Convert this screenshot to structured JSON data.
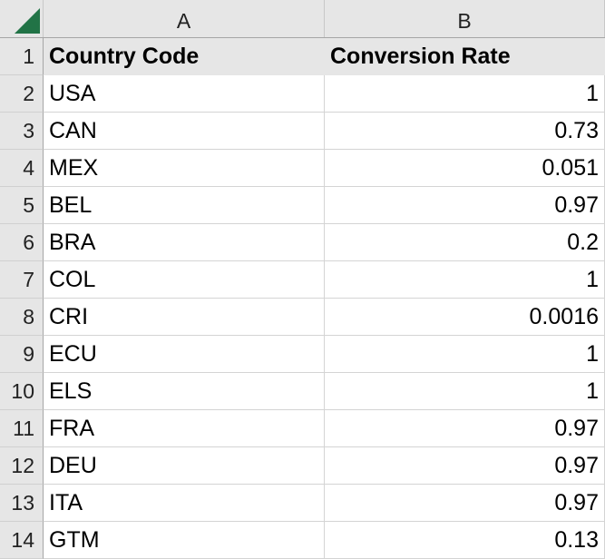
{
  "columns": [
    "A",
    "B"
  ],
  "header": {
    "row": "1",
    "a": "Country Code",
    "b": "Conversion Rate"
  },
  "rows": [
    {
      "row": "2",
      "code": "USA",
      "rate": "1"
    },
    {
      "row": "3",
      "code": "CAN",
      "rate": "0.73"
    },
    {
      "row": "4",
      "code": "MEX",
      "rate": "0.051"
    },
    {
      "row": "5",
      "code": "BEL",
      "rate": "0.97"
    },
    {
      "row": "6",
      "code": "BRA",
      "rate": "0.2"
    },
    {
      "row": "7",
      "code": "COL",
      "rate": "1"
    },
    {
      "row": "8",
      "code": "CRI",
      "rate": "0.0016"
    },
    {
      "row": "9",
      "code": "ECU",
      "rate": "1"
    },
    {
      "row": "10",
      "code": "ELS",
      "rate": "1"
    },
    {
      "row": "11",
      "code": "FRA",
      "rate": "0.97"
    },
    {
      "row": "12",
      "code": "DEU",
      "rate": "0.97"
    },
    {
      "row": "13",
      "code": "ITA",
      "rate": "0.97"
    },
    {
      "row": "14",
      "code": "GTM",
      "rate": "0.13"
    }
  ]
}
